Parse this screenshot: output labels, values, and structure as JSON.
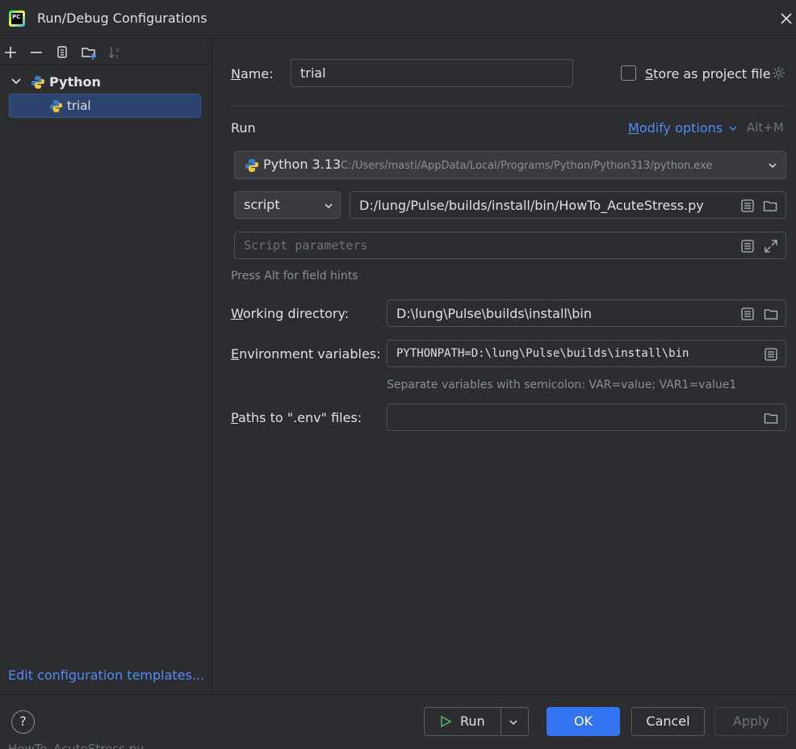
{
  "window": {
    "title": "Run/Debug Configurations",
    "app_icon_text": "PC",
    "close_icon": "close-icon"
  },
  "sidebar": {
    "toolbar": [
      "add-icon",
      "remove-icon",
      "copy-icon",
      "new-folder-icon",
      "sort-icon"
    ],
    "tree": {
      "group_label": "Python",
      "item_label": "trial"
    },
    "templates_link": "Edit configuration templates..."
  },
  "form": {
    "name_label_u": "N",
    "name_label_rest": "ame:",
    "name_value": "trial",
    "store_u": "S",
    "store_rest": "tore as project file",
    "store_checked": false,
    "section_title": "Run",
    "modify_u": "M",
    "modify_rest": "odify options",
    "modify_shortcut": "Alt+M",
    "interpreter_name": "Python 3.13",
    "interpreter_path": "C:/Users/masti/AppData/Local/Programs/Python/Python313/python.exe",
    "target_type": "script",
    "script_path": "D:/lung/Pulse/builds/install/bin/HowTo_AcuteStress.py",
    "params_placeholder": "Script parameters",
    "alt_hint": "Press Alt for field hints",
    "workdir_u": "W",
    "workdir_rest": "orking directory:",
    "workdir_value": "D:\\lung\\Pulse\\builds\\install\\bin",
    "env_u": "E",
    "env_rest": "nvironment variables:",
    "env_value": "PYTHONPATH=D:\\lung\\Pulse\\builds\\install\\bin",
    "env_hint": "Separate variables with semicolon: VAR=value; VAR1=value1",
    "dotenv_u": "P",
    "dotenv_rest": "aths to \".env\" files:",
    "dotenv_value": ""
  },
  "footer": {
    "help": "?",
    "run_label": "Run",
    "ok_label": "OK",
    "cancel_label": "Cancel",
    "apply_label": "Apply",
    "behind_text": "HowTo_AcuteStress.py"
  },
  "colors": {
    "accent": "#3574f0",
    "link": "#548af7",
    "selection": "#2e436e",
    "background": "#2b2d30"
  }
}
